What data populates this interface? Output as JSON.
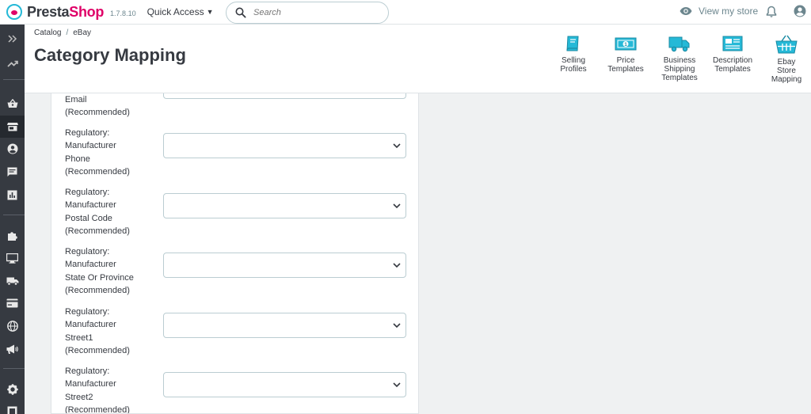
{
  "header": {
    "logo_part1": "Presta",
    "logo_part2": "Shop",
    "version": "1.7.8.10",
    "quick_access": "Quick Access",
    "search_placeholder": "Search",
    "view_store": "View my store"
  },
  "sidebar": {
    "items": [
      {
        "icon": "expand-icon"
      },
      {
        "icon": "trending-up-icon"
      },
      {
        "icon": "shopping-basket-icon"
      },
      {
        "icon": "store-icon"
      },
      {
        "icon": "account-circle-icon"
      },
      {
        "icon": "chat-icon"
      },
      {
        "icon": "bar-chart-icon"
      },
      {
        "icon": "puzzle-icon"
      },
      {
        "icon": "desktop-icon"
      },
      {
        "icon": "truck-icon"
      },
      {
        "icon": "credit-card-icon"
      },
      {
        "icon": "globe-icon"
      },
      {
        "icon": "megaphone-icon"
      },
      {
        "icon": "gear-icon"
      },
      {
        "icon": "box-icon"
      }
    ]
  },
  "breadcrumb": [
    "Catalog",
    "eBay"
  ],
  "page_title": "Category Mapping",
  "toolbar": [
    {
      "line1": "Selling",
      "line2": "Profiles",
      "line3": ""
    },
    {
      "line1": "Price",
      "line2": "Templates",
      "line3": ""
    },
    {
      "line1": "Business",
      "line2": "Shipping",
      "line3": "Templates"
    },
    {
      "line1": "Description",
      "line2": "Templates",
      "line3": ""
    },
    {
      "line1": "Ebay",
      "line2": "Store",
      "line3": "Mapping"
    }
  ],
  "form": {
    "fields": [
      {
        "line1": "Email",
        "line2": "(Recommended)",
        "line3": "",
        "line4": ""
      },
      {
        "line1": "Regulatory:",
        "line2": "Manufacturer",
        "line3": "Phone",
        "line4": "(Recommended)"
      },
      {
        "line1": "Regulatory:",
        "line2": "Manufacturer",
        "line3": "Postal Code",
        "line4": "(Recommended)"
      },
      {
        "line1": "Regulatory:",
        "line2": "Manufacturer",
        "line3": "State Or Province",
        "line4": "(Recommended)"
      },
      {
        "line1": "Regulatory:",
        "line2": "Manufacturer",
        "line3": "Street1",
        "line4": "(Recommended)"
      },
      {
        "line1": "Regulatory:",
        "line2": "Manufacturer",
        "line3": "Street2",
        "line4": "(Recommended)"
      }
    ]
  },
  "colors": {
    "accent": "#25b9d7",
    "brand_pink": "#df0067",
    "sidebar_bg": "#363a41"
  }
}
